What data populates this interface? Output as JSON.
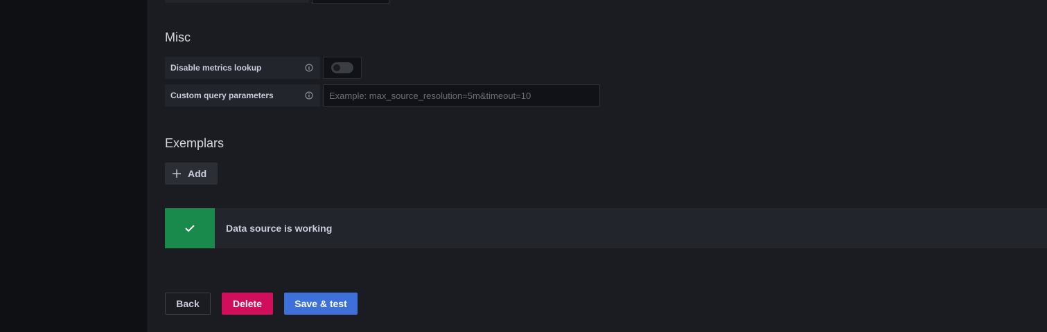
{
  "misc": {
    "title": "Misc",
    "disable_metrics_lookup": {
      "label": "Disable metrics lookup",
      "icon": "info-icon",
      "enabled": false
    },
    "custom_query_parameters": {
      "label": "Custom query parameters",
      "icon": "info-icon",
      "value": "",
      "placeholder": "Example: max_source_resolution=5m&timeout=10"
    }
  },
  "exemplars": {
    "title": "Exemplars",
    "add_label": "Add",
    "add_icon": "plus-icon"
  },
  "alert": {
    "status": "success",
    "icon": "check-icon",
    "message": "Data source is working",
    "color": "#1a8a4c"
  },
  "actions": {
    "back_label": "Back",
    "delete_label": "Delete",
    "save_label": "Save & test",
    "delete_color": "#d10e5c",
    "save_color": "#3d71d9"
  }
}
